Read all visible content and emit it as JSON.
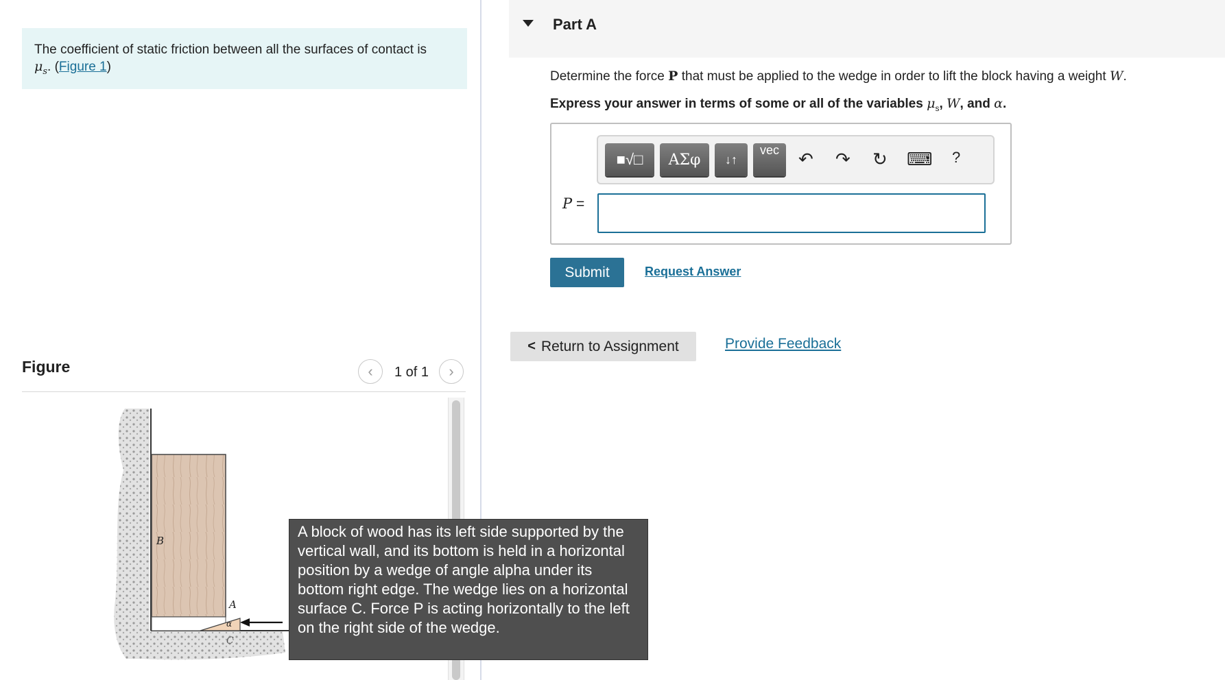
{
  "intro": {
    "text": "The coefficient of static friction between all the surfaces of contact is",
    "mu_symbol": "μ",
    "mu_subscript": "s",
    "figure_link_label": "Figure 1"
  },
  "figure": {
    "title": "Figure",
    "counter": "1 of 1",
    "prev_icon": "chevron-left",
    "next_icon": "chevron-right",
    "labels": {
      "wall": "B",
      "top": "A",
      "angle": "α",
      "floor": "C"
    },
    "alt_text": "A block of wood has its left side supported by the vertical wall, and its bottom is held in a horizontal position by a wedge of angle alpha under its bottom right edge. The wedge lies on a horizontal surface C. Force P is acting horizontally to the left on the right side of the wedge."
  },
  "part": {
    "title": "Part A",
    "question_pre": "Determine the force",
    "question_var_p": "P",
    "question_mid": "that must be applied to the wedge in order to lift the block having a weight",
    "question_var_w": "W",
    "question_end": ".",
    "instruction_pre": "Express your answer in terms of some or all of the variables",
    "instruction_mu": "μ",
    "instruction_mu_sub": "s",
    "instruction_w": "W",
    "instruction_and": ", and",
    "instruction_alpha": "α",
    "instruction_end": "."
  },
  "toolbar": {
    "templates_label": "■√□",
    "greek_label": "ΑΣφ",
    "arrows_label": "↓↑",
    "vec_label": "vec",
    "undo_icon": "↶",
    "redo_icon": "↷",
    "reset_icon": "↻",
    "keyboard_icon": "⌨",
    "help_label": "?"
  },
  "answer": {
    "label": "P",
    "equals": "=",
    "value": ""
  },
  "actions": {
    "submit": "Submit",
    "request_answer": "Request Answer",
    "return_to_assignment": "Return to Assignment",
    "provide_feedback": "Provide Feedback"
  },
  "colors": {
    "accent": "#2b7295",
    "link": "#1a6f97",
    "intro_bg": "#e6f5f6",
    "tooltip_bg": "#4f4f4f"
  }
}
